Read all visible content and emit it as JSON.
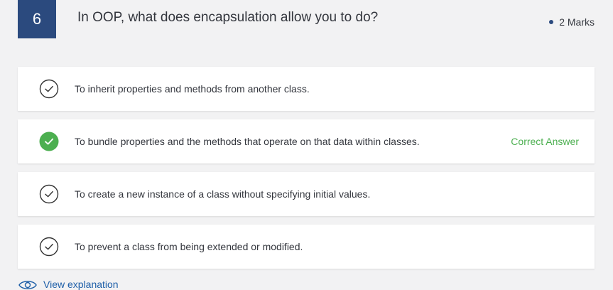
{
  "question": {
    "number": "6",
    "text": "In OOP, what does encapsulation allow you to do?",
    "marks": "2 Marks"
  },
  "options": [
    {
      "text": "To inherit properties and methods from another class.",
      "correct": false
    },
    {
      "text": "To bundle properties and the methods that operate on that data within classes.",
      "correct": true
    },
    {
      "text": "To create a new instance of a class without specifying initial values.",
      "correct": false
    },
    {
      "text": "To prevent a class from being extended or modified.",
      "correct": false
    }
  ],
  "correct_label": "Correct Answer",
  "explanation_link": "View explanation",
  "colors": {
    "accent": "#2b4a7e",
    "correct": "#4caf50",
    "link": "#1e5fa8"
  }
}
